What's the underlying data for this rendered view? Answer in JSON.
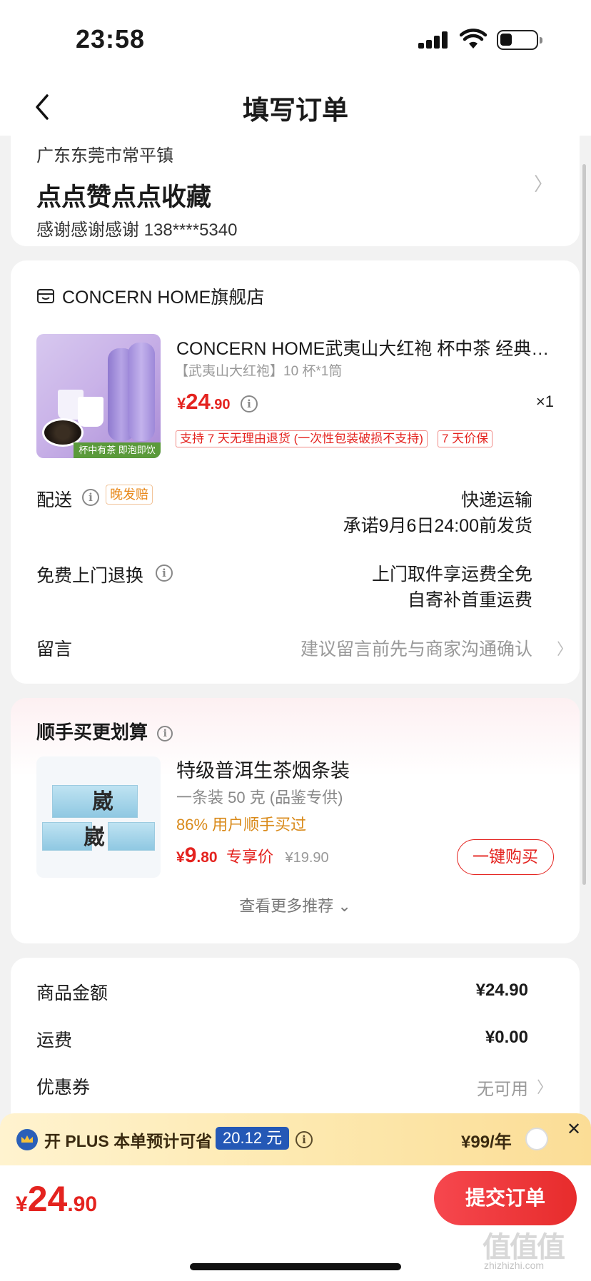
{
  "status": {
    "time": "23:58"
  },
  "nav": {
    "title": "填写订单"
  },
  "address": {
    "region": "广东东莞市常平镇",
    "detail": "点点赞点点收藏",
    "contact": "感谢感谢感谢  138****5340"
  },
  "shop": {
    "name": "CONCERN HOME旗舰店",
    "product": {
      "title": "CONCERN HOME武夷山大红袍 杯中茶 经典…",
      "spec": "【武夷山大红袍】10 杯*1筒",
      "price_currency": "¥",
      "price_int": "24",
      "price_dec": ".90",
      "qty": "×1",
      "image_text": "杯中有茶 即泡即饮",
      "tags": [
        "支持 7 天无理由退货 (一次性包装破损不支持)",
        "7 天价保"
      ]
    },
    "delivery": {
      "label": "配送",
      "late_tag": "晚发赔",
      "method": "快递运输",
      "promise": "承诺9月6日24:00前发货"
    },
    "return": {
      "label": "免费上门退换",
      "line1": "上门取件享运费全免",
      "line2": "自寄补首重运费"
    },
    "note": {
      "label": "留言",
      "placeholder": "建议留言前先与商家沟通确认"
    }
  },
  "recommend": {
    "title": "顺手买更划算",
    "name": "特级普洱生茶烟条装",
    "sub": "一条装 50 克 (品鉴专供)",
    "bought": "86% 用户顺手买过",
    "price_currency": "¥",
    "price_int": "9",
    "price_dec": ".80",
    "price_tag": "专享价",
    "orig_price": "¥19.90",
    "buy_label": "一键购买",
    "more_label": "查看更多推荐 ⌄"
  },
  "summary": {
    "goods_label": "商品金额",
    "goods_value": "¥24.90",
    "shipping_label": "运费",
    "shipping_value": "¥0.00",
    "coupon_label": "优惠券",
    "coupon_value": "无可用"
  },
  "plus": {
    "text": "开 PLUS 本单预计可省",
    "save": "20.12 元",
    "year_price": "¥99/年"
  },
  "bottom": {
    "total_currency": "¥",
    "total_int": "24",
    "total_dec": ".90",
    "submit_label": "提交订单",
    "watermark": "值值值",
    "watermark_sub": "zhizhizhi.com"
  },
  "colors": {
    "accent": "#e4231f",
    "plus_blue": "#2458b6"
  }
}
